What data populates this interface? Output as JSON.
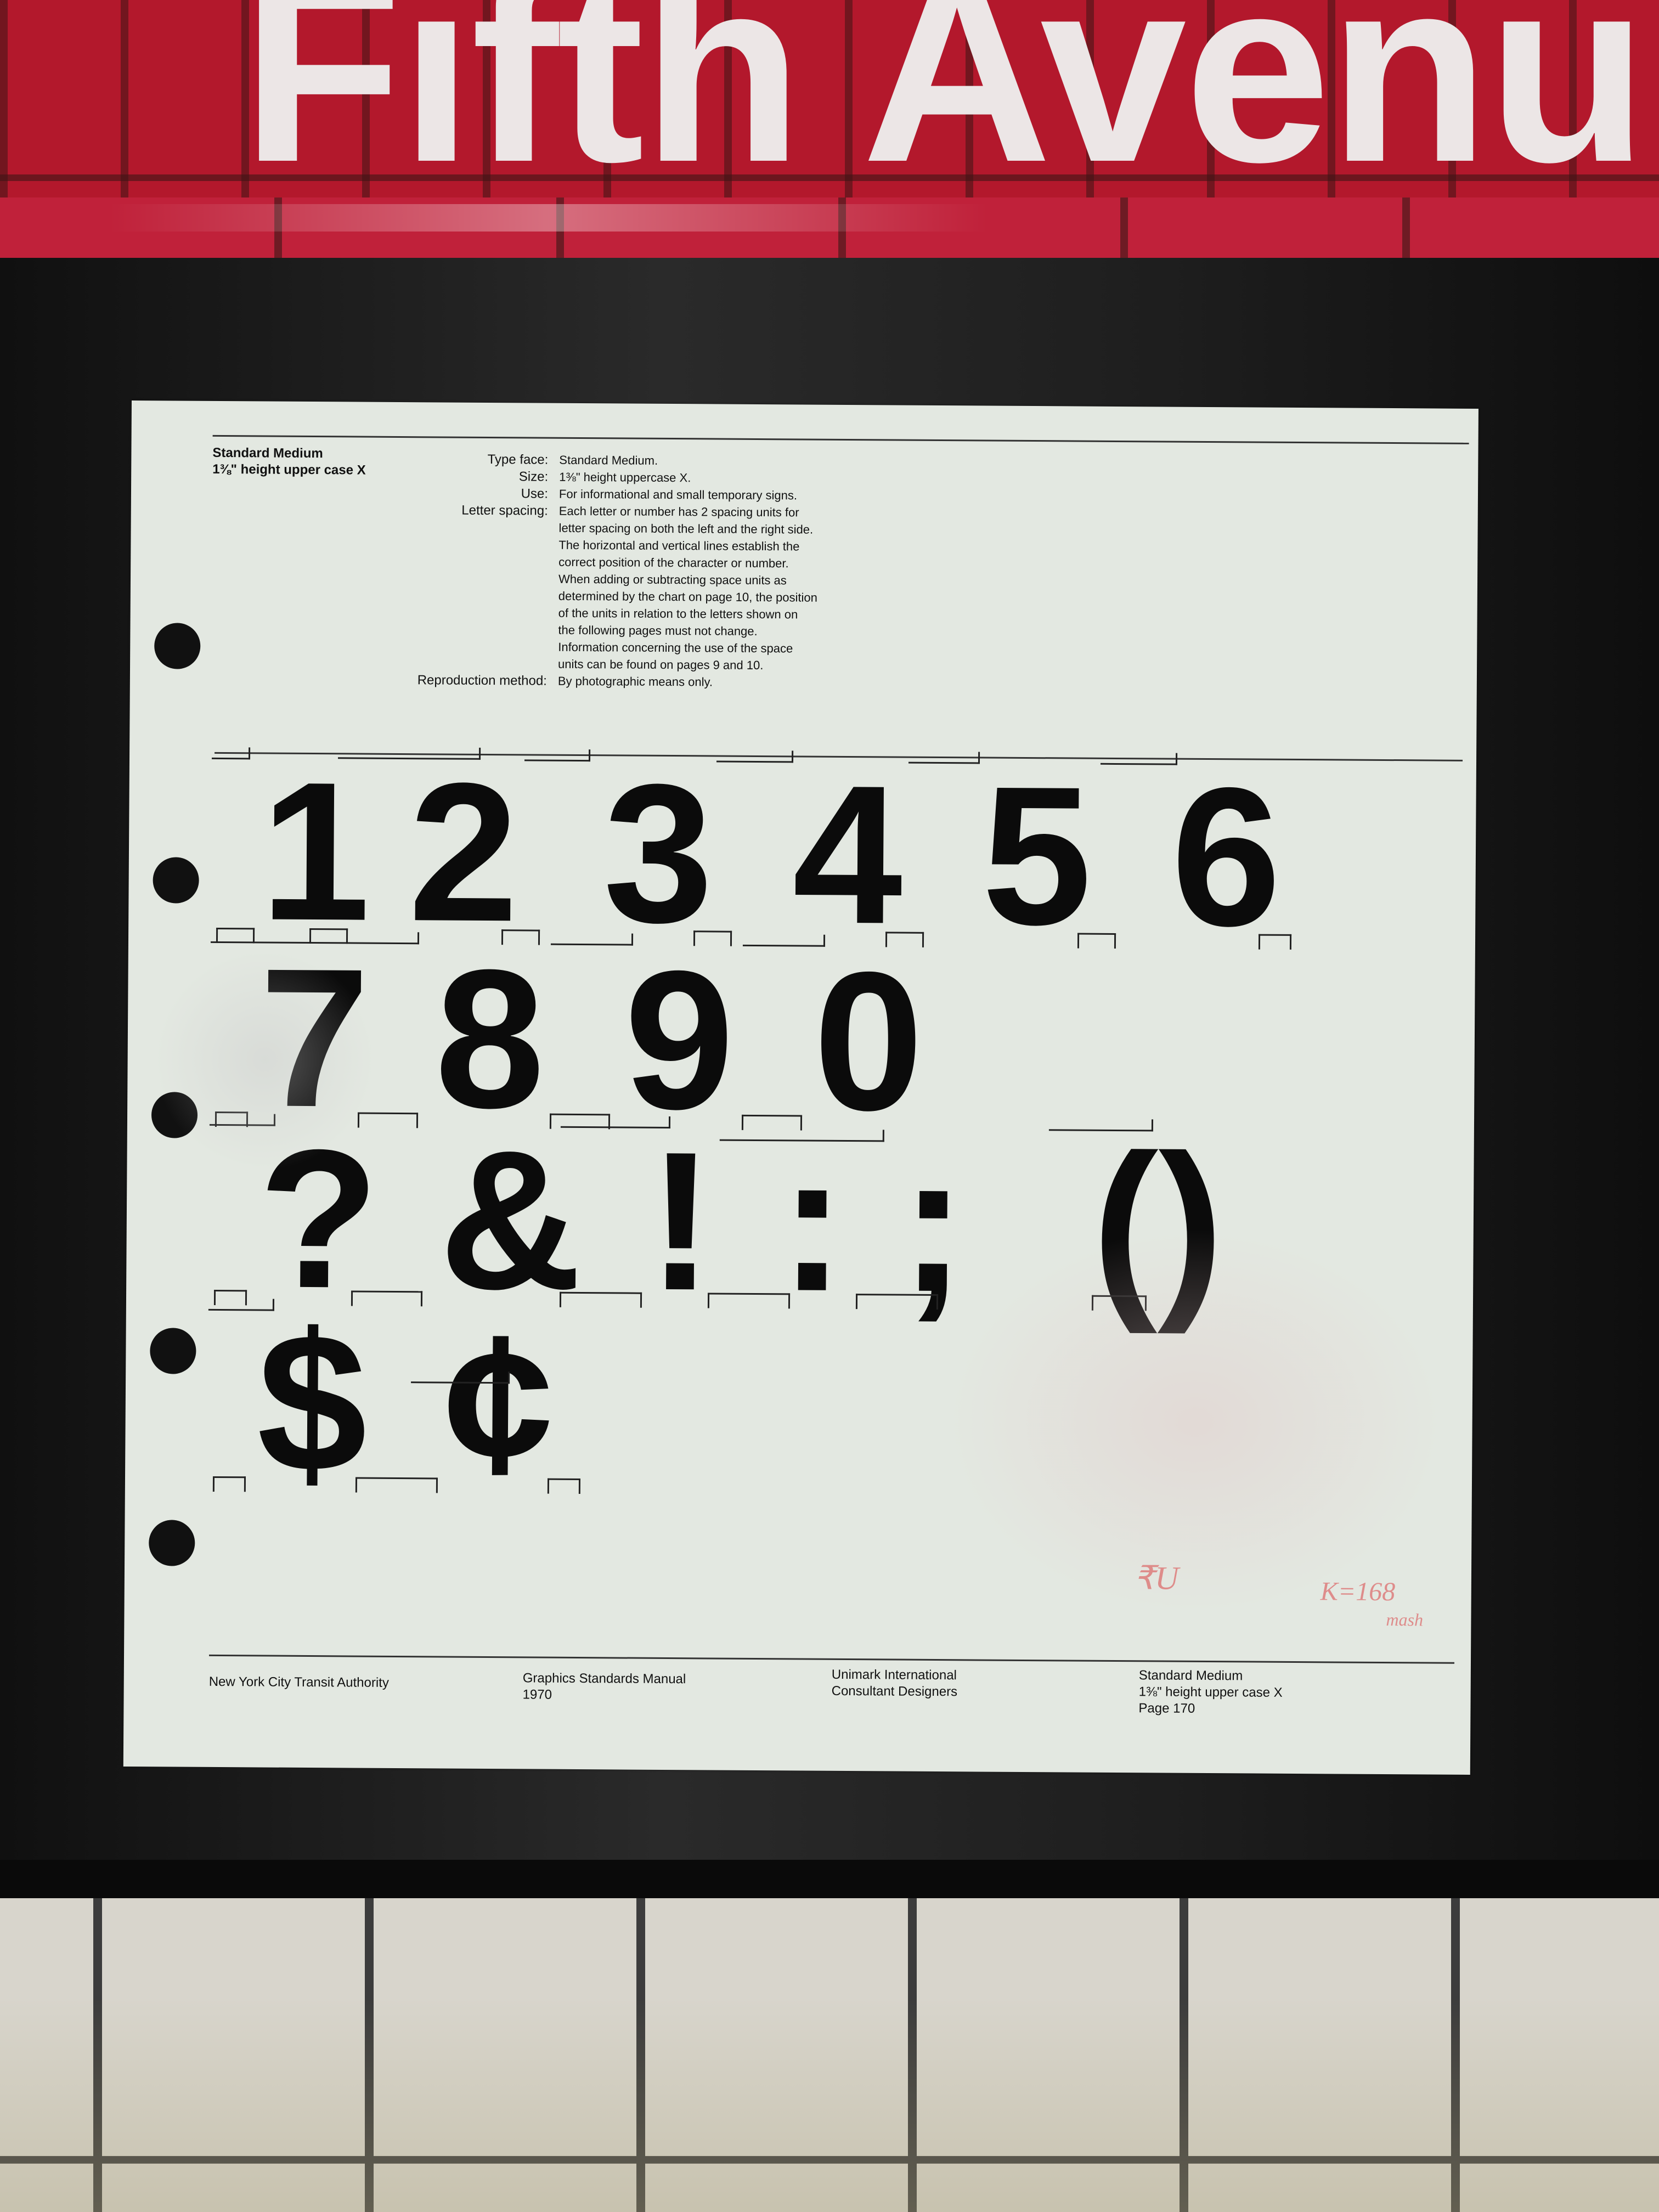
{
  "station": {
    "name": "Fifth Avenu"
  },
  "sheet": {
    "header": {
      "title_line1": "Standard Medium",
      "title_line2": "1⅜\" height upper case X",
      "labels": [
        "Type face:",
        "Size:",
        "Use:",
        "Letter spacing:",
        "",
        "",
        "",
        "",
        "",
        "",
        "",
        "",
        "Reproduction method:"
      ],
      "values": [
        "Standard Medium.",
        "1⅜\" height uppercase X.",
        "For informational and small temporary signs.",
        "Each letter or number has 2 spacing units for",
        "letter spacing on both the left and the right side.",
        "The horizontal and vertical lines establish the",
        "correct position of the character or number.",
        "When adding or subtracting space units as",
        "determined by the chart on page 10, the position",
        "of the units in relation to the letters shown on",
        "the following pages must not change.",
        "Information concerning the use of the space",
        "units can be found on pages 9 and 10.",
        "By photographic means only."
      ]
    },
    "rows": [
      [
        "1",
        "2",
        "3",
        "4",
        "5",
        "6"
      ],
      [
        "7",
        "8",
        "9",
        "0"
      ],
      [
        "?",
        "&",
        "!",
        ":",
        ";",
        "()"
      ],
      [
        "$",
        "¢"
      ]
    ],
    "footer": {
      "authority": "New York City Transit Authority",
      "manual_title": "Graphics Standards Manual",
      "manual_year": "1970",
      "designer_line1": "Unimark International",
      "designer_line2": "Consultant Designers",
      "page_line1": "Standard Medium",
      "page_line2": "1⅜\" height upper case X",
      "page_line3": "Page 170"
    },
    "graffiti": [
      "₹U",
      "K=168",
      "mash"
    ]
  },
  "colors": {
    "red_tile": "#b3182c",
    "sheet": "#e3e8e1",
    "ink": "#0b0b0b",
    "frame": "#1a1a1a",
    "white_tile": "#d8d5cc"
  }
}
